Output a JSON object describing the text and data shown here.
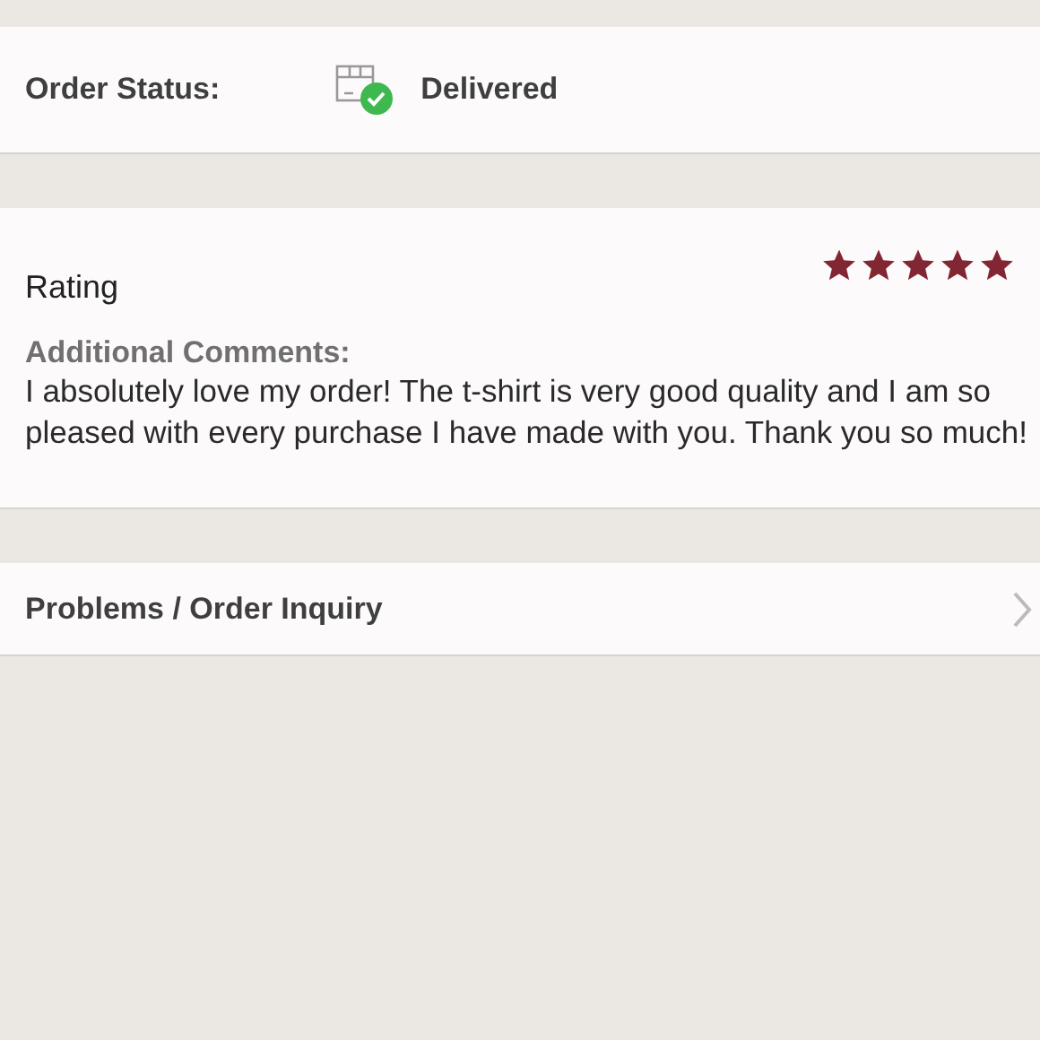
{
  "order_status": {
    "label": "Order Status:",
    "value": "Delivered"
  },
  "rating": {
    "label": "Rating",
    "stars": 5,
    "comments_label": "Additional Comments:",
    "comments": "I absolutely love my order! The t-shirt is very good quality and I am so pleased with every purchase I have made with you. Thank you so much!"
  },
  "inquiry": {
    "label": "Problems / Order Inquiry"
  }
}
